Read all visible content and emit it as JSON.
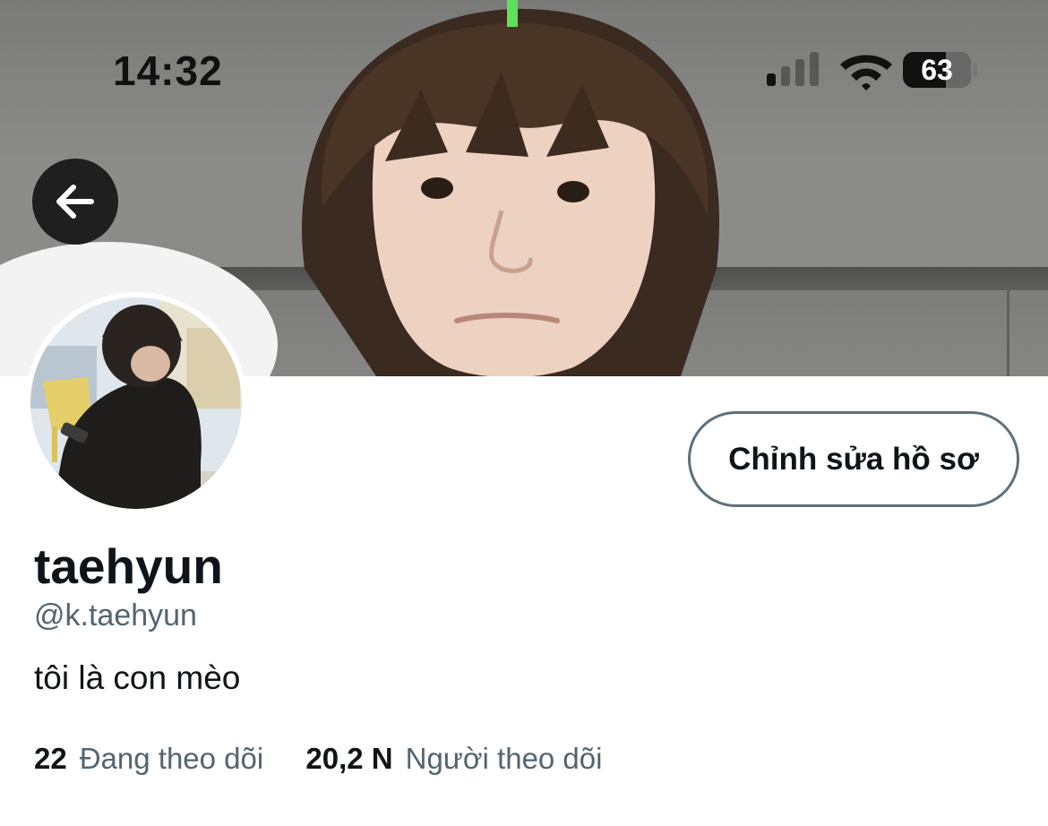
{
  "status_bar": {
    "time": "14:32",
    "battery_level": "63",
    "signal_icon": "cellular-signal-icon",
    "wifi_icon": "wifi-icon"
  },
  "header": {
    "back_icon": "arrow-left-icon"
  },
  "profile": {
    "display_name": "taehyun",
    "username": "@k.taehyun",
    "bio": "tôi là con mèo",
    "edit_button_label": "Chỉnh sửa hồ sơ",
    "following_count": "22",
    "following_label": "Đang theo dõi",
    "followers_count": "20,2 N",
    "followers_label": "Người theo dõi"
  },
  "colors": {
    "text_primary": "#0f1419",
    "text_secondary": "#536471",
    "button_border": "#5e6f7c"
  }
}
